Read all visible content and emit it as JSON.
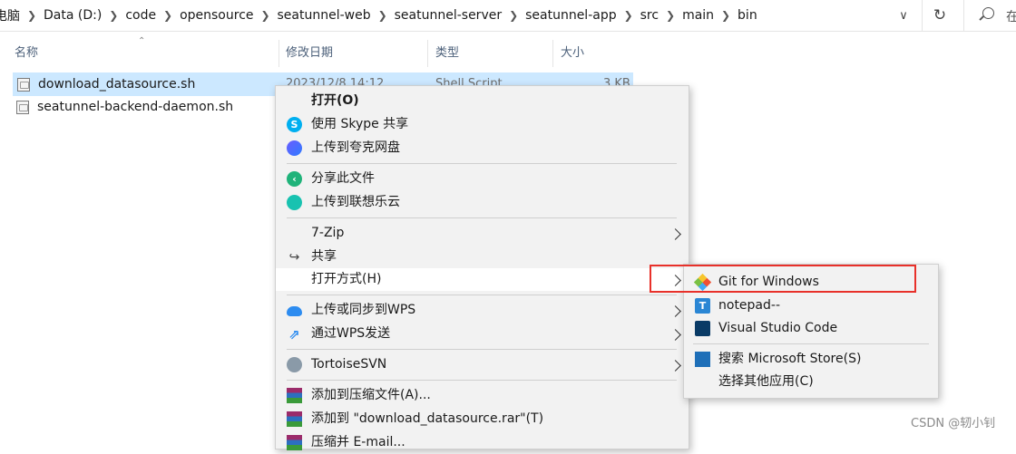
{
  "address_bar": {
    "crumbs": [
      "电脑",
      "Data (D:)",
      "code",
      "opensource",
      "seatunnel-web",
      "seatunnel-server",
      "seatunnel-app",
      "src",
      "main",
      "bin"
    ],
    "search_placeholder": "在"
  },
  "columns": {
    "name": "名称",
    "modified": "修改日期",
    "type": "类型",
    "size": "大小"
  },
  "files": [
    {
      "name": "download_datasource.sh",
      "modified": "2023/12/8 14:12",
      "type": "Shell Script",
      "size": "3 KB",
      "selected": true
    },
    {
      "name": "seatunnel-backend-daemon.sh",
      "selected": false
    }
  ],
  "context_menu": {
    "items": [
      {
        "label": "打开(O)",
        "icon": "none"
      },
      {
        "label": "使用 Skype 共享",
        "icon": "skype-icon"
      },
      {
        "label": "上传到夸克网盘",
        "icon": "quark-icon"
      },
      {
        "label": "分享此文件",
        "icon": "share-green-icon"
      },
      {
        "label": "上传到联想乐云",
        "icon": "lenovo-cloud-icon"
      },
      {
        "label": "7-Zip",
        "icon": "none"
      },
      {
        "label": "共享",
        "icon": "share-icon"
      },
      {
        "label": "打开方式(H)",
        "icon": "none"
      },
      {
        "label": "上传或同步到WPS",
        "icon": "wps-cloud-icon"
      },
      {
        "label": "通过WPS发送",
        "icon": "wps-send-icon"
      },
      {
        "label": "TortoiseSVN",
        "icon": "tortoise-svn-icon"
      },
      {
        "label": "添加到压缩文件(A)...",
        "icon": "winrar-icon"
      },
      {
        "label": "添加到 \"download_datasource.rar\"(T)",
        "icon": "winrar-icon"
      },
      {
        "label": "压缩并 E-mail...",
        "icon": "winrar-icon"
      }
    ]
  },
  "open_with_submenu": {
    "items": [
      {
        "label": "Git for Windows",
        "icon": "git-icon"
      },
      {
        "label": "notepad--",
        "icon": "notepad-icon"
      },
      {
        "label": "Visual Studio Code",
        "icon": "vscode-icon"
      },
      {
        "label": "搜索 Microsoft Store(S)",
        "icon": "store-icon"
      },
      {
        "label": "选择其他应用(C)",
        "icon": "none"
      }
    ]
  },
  "colors": {
    "selection": "#cce8ff",
    "highlight_box": "#e8312a",
    "menu_bg": "#f2f2f2"
  },
  "watermark": "CSDN @轫小钊"
}
